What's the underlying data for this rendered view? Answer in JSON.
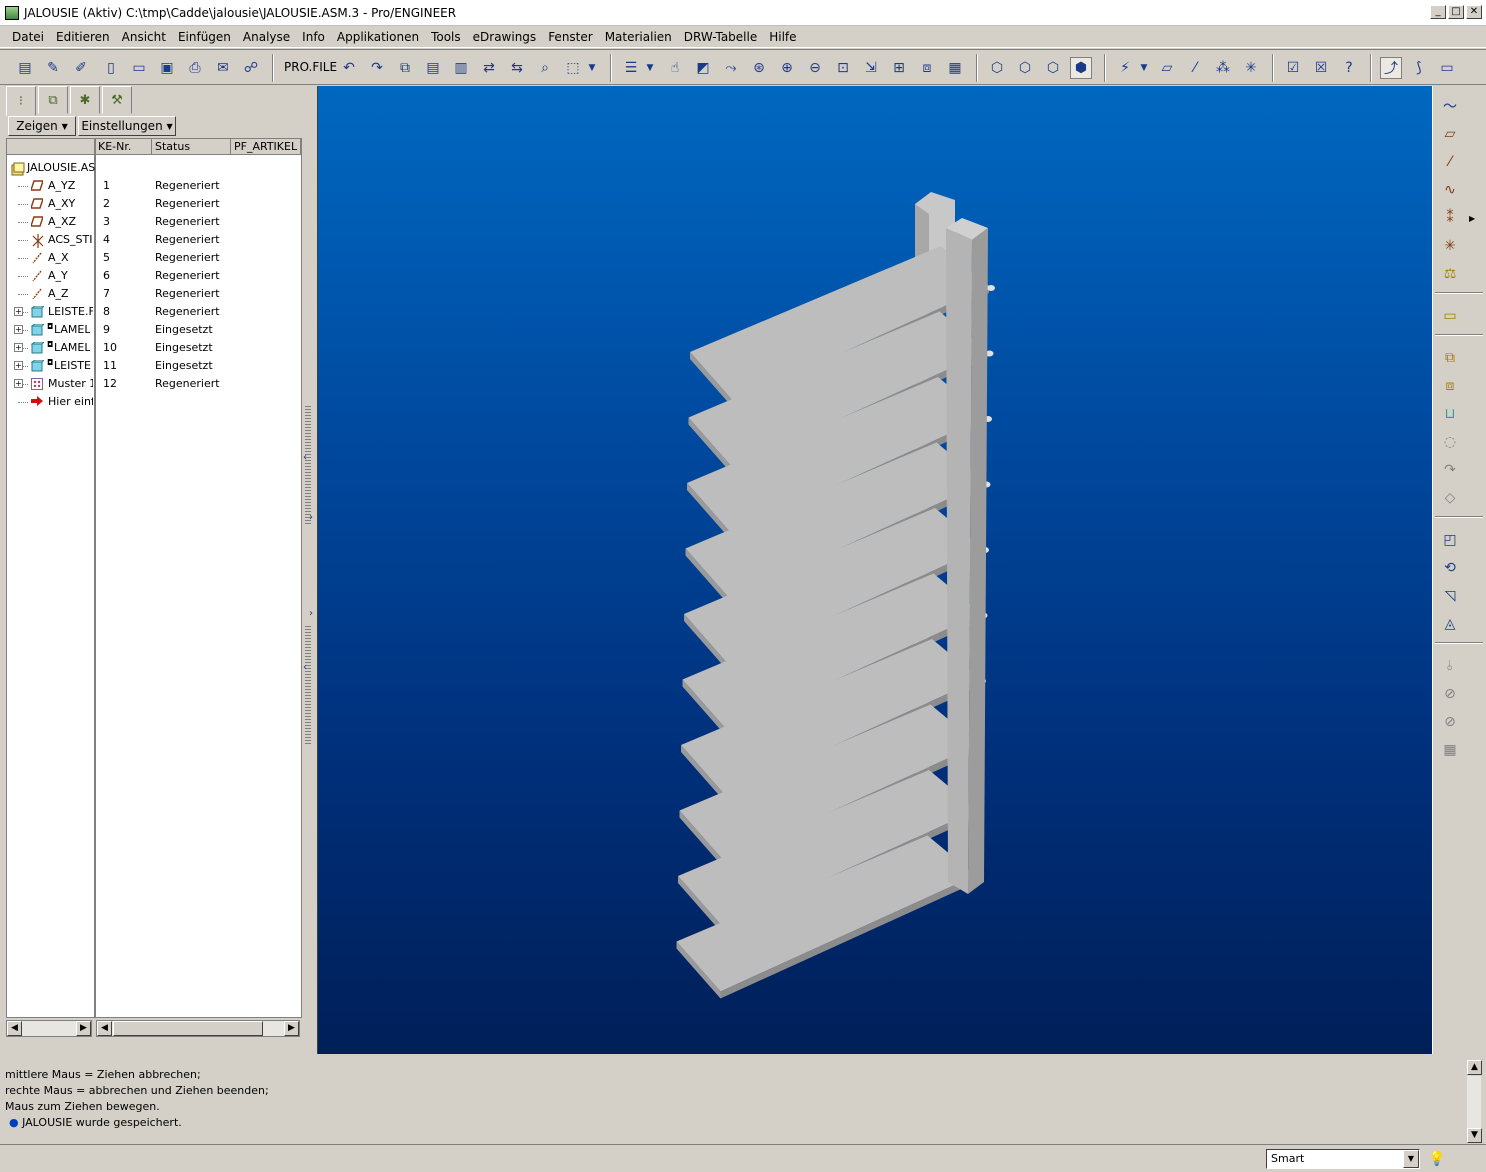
{
  "window": {
    "title": "JALOUSIE (Aktiv) C:\\tmp\\Cadde\\jalousie\\JALOUSIE.ASM.3 - Pro/ENGINEER",
    "minimize": "_",
    "maximize": "□",
    "close": "✕"
  },
  "menu": [
    "Datei",
    "Editieren",
    "Ansicht",
    "Einfügen",
    "Analyse",
    "Info",
    "Applikationen",
    "Tools",
    "eDrawings",
    "Fenster",
    "Materialien",
    "DRW-Tabelle",
    "Hilfe"
  ],
  "toolbar": {
    "profile_label": "PRO.FILE"
  },
  "panel": {
    "show_button": "Zeigen",
    "settings_button": "Einstellungen",
    "columns": [
      "KE-Nr.",
      "Status",
      "PF_ARTIKEL"
    ],
    "root": "JALOUSIE.AS",
    "rows": [
      {
        "name": "A_YZ",
        "nr": "1",
        "status": "Regeneriert",
        "icon": "datum-plane-icon",
        "expandable": false,
        "pinned": false
      },
      {
        "name": "A_XY",
        "nr": "2",
        "status": "Regeneriert",
        "icon": "datum-plane-icon",
        "expandable": false,
        "pinned": false
      },
      {
        "name": "A_XZ",
        "nr": "3",
        "status": "Regeneriert",
        "icon": "datum-plane-icon",
        "expandable": false,
        "pinned": false
      },
      {
        "name": "ACS_STI",
        "nr": "4",
        "status": "Regeneriert",
        "icon": "coordinate-system-icon",
        "expandable": false,
        "pinned": false
      },
      {
        "name": "A_X",
        "nr": "5",
        "status": "Regeneriert",
        "icon": "datum-axis-icon",
        "expandable": false,
        "pinned": false
      },
      {
        "name": "A_Y",
        "nr": "6",
        "status": "Regeneriert",
        "icon": "datum-axis-icon",
        "expandable": false,
        "pinned": false
      },
      {
        "name": "A_Z",
        "nr": "7",
        "status": "Regeneriert",
        "icon": "datum-axis-icon",
        "expandable": false,
        "pinned": false
      },
      {
        "name": "LEISTE.F",
        "nr": "8",
        "status": "Regeneriert",
        "icon": "part-icon",
        "expandable": true,
        "pinned": false
      },
      {
        "name": "LAMEL",
        "nr": "9",
        "status": "Eingesetzt",
        "icon": "part-icon",
        "expandable": true,
        "pinned": true
      },
      {
        "name": "LAMEL",
        "nr": "10",
        "status": "Eingesetzt",
        "icon": "part-icon",
        "expandable": true,
        "pinned": true
      },
      {
        "name": "LEISTE",
        "nr": "11",
        "status": "Eingesetzt",
        "icon": "part-icon",
        "expandable": true,
        "pinned": true
      },
      {
        "name": "Muster 1",
        "nr": "12",
        "status": "Regeneriert",
        "icon": "pattern-icon",
        "expandable": true,
        "pinned": false
      },
      {
        "name": "Hier einfü",
        "nr": "",
        "status": "",
        "icon": "insert-here-arrow-icon",
        "expandable": false,
        "pinned": false
      }
    ]
  },
  "messages": [
    "mittlere Maus = Ziehen abbrechen;",
    "rechte Maus = abbrechen und Ziehen beenden;",
    "Maus zum Ziehen bewegen.",
    "JALOUSIE wurde gespeichert."
  ],
  "status": {
    "filter_value": "Smart"
  },
  "colors": {
    "viewport_top": "#0068c0",
    "viewport_bottom": "#001f58",
    "model_gray": "#b8b8b8"
  }
}
